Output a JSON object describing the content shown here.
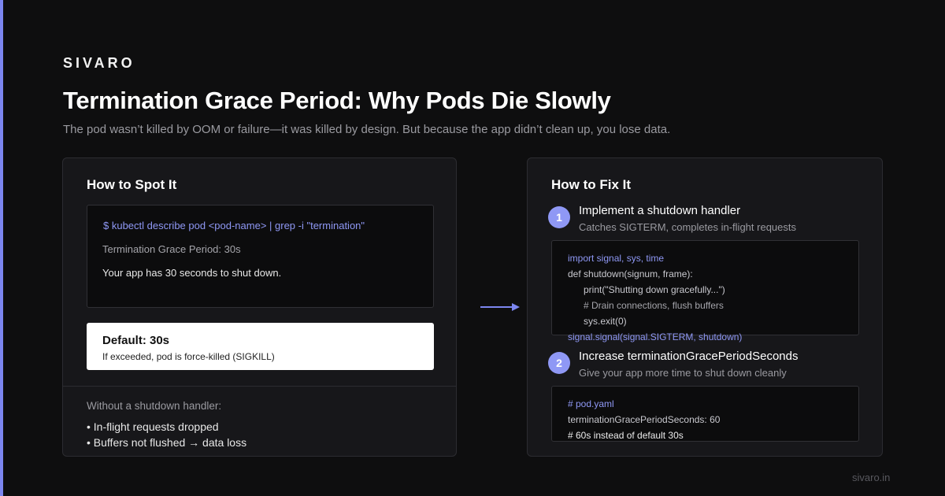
{
  "brand": "SIVARO",
  "title": "Termination Grace Period: Why Pods Die Slowly",
  "subtitle": "The pod wasn’t killed by OOM or failure—it was killed by design. But because the app didn’t clean up, you lose data.",
  "spot": {
    "heading": "How to Spot It",
    "command": "$ kubectl describe pod <pod-name> | grep -i \"termination\"",
    "output_line": "Termination Grace Period: 30s",
    "explain_line": "Your app has 30 seconds to shut down.",
    "default_title": "Default: 30s",
    "default_sub": "If exceeded, pod is force-killed (SIGKILL)",
    "warning_label": "Without a shutdown handler:",
    "bullets": [
      "• In-flight requests dropped",
      "• Buffers not flushed → data loss"
    ]
  },
  "fix": {
    "heading": "How to Fix It",
    "steps": [
      {
        "number": "1",
        "title": "Implement a shutdown handler",
        "description": "Catches SIGTERM, completes in-flight requests",
        "code": [
          "import signal, sys, time",
          "def shutdown(signum, frame):",
          "print(\"Shutting down gracefully...\")",
          "# Drain connections, flush buffers",
          "sys.exit(0)",
          "signal.signal(signal.SIGTERM, shutdown)"
        ]
      },
      {
        "number": "2",
        "title": "Increase terminationGracePeriodSeconds",
        "description": "Give your app more time to shut down cleanly",
        "code": [
          "# pod.yaml",
          "terminationGracePeriodSeconds: 60",
          "# 60s instead of default 30s"
        ]
      }
    ]
  },
  "footer": "sivaro.in",
  "colors": {
    "accent": "#8f98f5",
    "background": "#0e0e0f",
    "panel": "#17171a"
  },
  "icons": {
    "arrow": "right-arrow-icon"
  }
}
